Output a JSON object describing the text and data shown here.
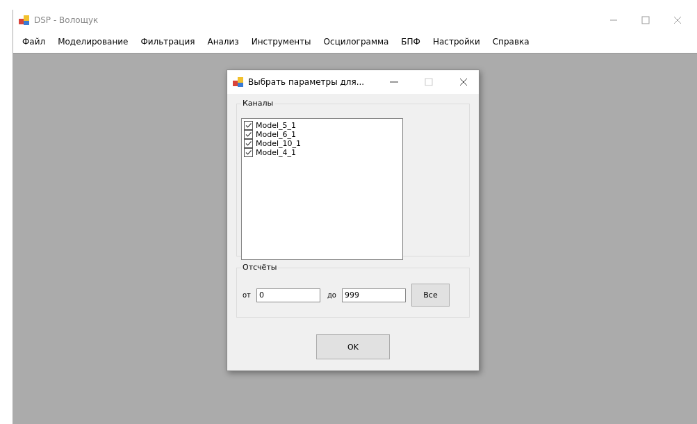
{
  "window": {
    "title": "DSP - Волощук"
  },
  "menu": [
    {
      "label": "Файл"
    },
    {
      "label": "Моделирование"
    },
    {
      "label": "Фильтрация"
    },
    {
      "label": "Анализ"
    },
    {
      "label": "Инструменты"
    },
    {
      "label": "Осцилограмма"
    },
    {
      "label": "БПФ"
    },
    {
      "label": "Настройки"
    },
    {
      "label": "Справка"
    }
  ],
  "dialog": {
    "title": "Выбрать параметры для...",
    "channels_group": {
      "title": "Каналы",
      "items": [
        {
          "label": "Model_5_1",
          "checked": true
        },
        {
          "label": "Model_6_1",
          "checked": true
        },
        {
          "label": "Model_10_1",
          "checked": true
        },
        {
          "label": "Model_4_1",
          "checked": true
        }
      ]
    },
    "samples_group": {
      "title": "Отсчёты",
      "from_label": "от",
      "from_value": "0",
      "to_label": "до",
      "to_value": "999",
      "all_button": "Все"
    },
    "ok_button": "OK"
  }
}
